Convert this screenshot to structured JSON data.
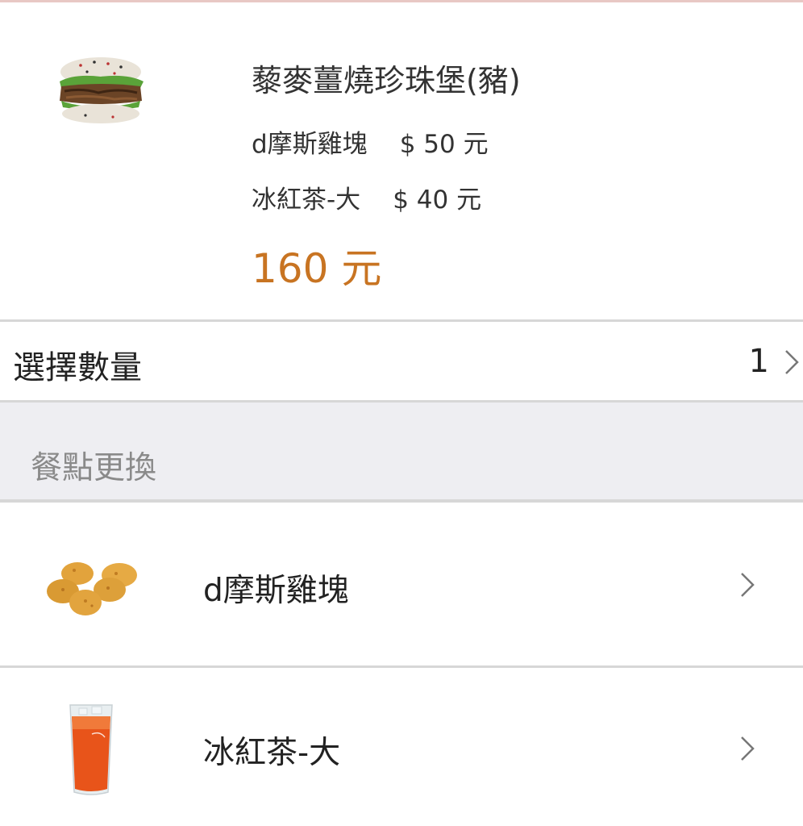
{
  "product": {
    "image_icon": "burger-image",
    "title": "藜麥薑燒珍珠堡(豬)",
    "sides": [
      {
        "name": "d摩斯雞塊",
        "price": "$ 50 元"
      },
      {
        "name": "冰紅茶-大",
        "price": "$ 40 元"
      }
    ],
    "total": "160 元",
    "total_color": "#c87422"
  },
  "quantity": {
    "label": "選擇數量",
    "value": "1",
    "icon": "chevron-right-icon"
  },
  "section": {
    "label": "餐點更換"
  },
  "items": [
    {
      "label": "d摩斯雞塊",
      "image_icon": "nuggets-image",
      "icon": "chevron-right-icon"
    },
    {
      "label": "冰紅茶-大",
      "image_icon": "iced-tea-image",
      "icon": "chevron-right-icon"
    }
  ]
}
